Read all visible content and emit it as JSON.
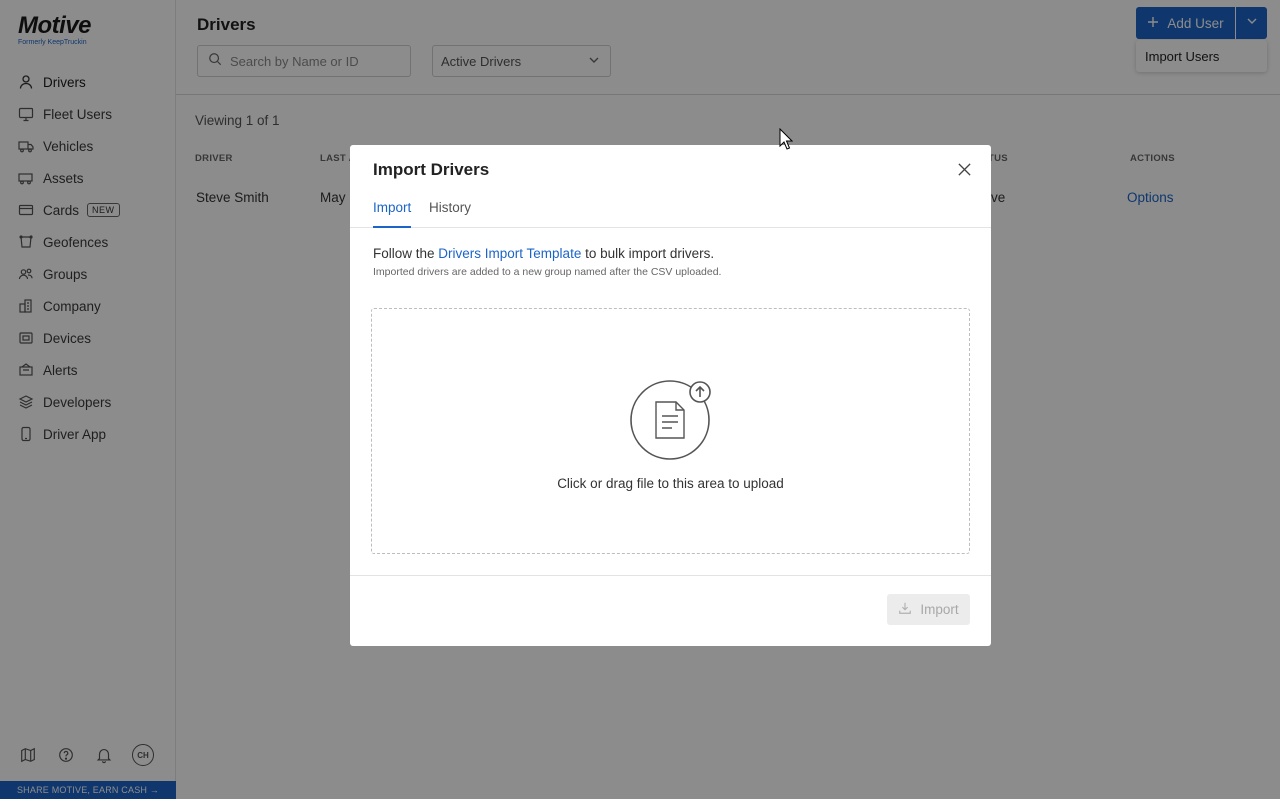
{
  "brand": {
    "name": "Motive",
    "subtitle": "Formerly KeepTruckin"
  },
  "sidebar": {
    "items": [
      {
        "label": "Drivers",
        "icon": "user-icon"
      },
      {
        "label": "Fleet Users",
        "icon": "monitor-icon"
      },
      {
        "label": "Vehicles",
        "icon": "truck-icon"
      },
      {
        "label": "Assets",
        "icon": "trailer-icon"
      },
      {
        "label": "Cards",
        "icon": "card-icon",
        "badge": "NEW"
      },
      {
        "label": "Geofences",
        "icon": "geofence-icon"
      },
      {
        "label": "Groups",
        "icon": "groups-icon"
      },
      {
        "label": "Company",
        "icon": "building-icon"
      },
      {
        "label": "Devices",
        "icon": "device-icon"
      },
      {
        "label": "Alerts",
        "icon": "alert-icon"
      },
      {
        "label": "Developers",
        "icon": "layers-icon"
      },
      {
        "label": "Driver App",
        "icon": "phone-icon"
      }
    ],
    "avatar_initials": "CH",
    "share_banner": "SHARE MOTIVE, EARN CASH →"
  },
  "header": {
    "title": "Drivers",
    "search_placeholder": "Search by Name or ID",
    "filter_value": "Active Drivers",
    "add_user_label": "Add User",
    "dropdown_item": "Import Users"
  },
  "list": {
    "viewing": "Viewing 1 of 1",
    "columns": {
      "driver": "DRIVER",
      "last": "LAST A",
      "status": "TUS",
      "actions": "ACTIONS"
    },
    "rows": [
      {
        "driver": "Steve Smith",
        "last": "May",
        "status": "ive",
        "action": "Options"
      }
    ]
  },
  "modal": {
    "title": "Import Drivers",
    "tabs": [
      "Import",
      "History"
    ],
    "instruction_pre": "Follow the ",
    "instruction_link": "Drivers Import Template",
    "instruction_post": " to bulk import drivers.",
    "instruction_sub": "Imported drivers are added to a new group named after the CSV uploaded.",
    "dropzone_text": "Click or drag file to this area to upload",
    "import_button": "Import"
  },
  "colors": {
    "accent": "#1d64c8",
    "overlay": "rgba(0,0,0,0.45)"
  }
}
